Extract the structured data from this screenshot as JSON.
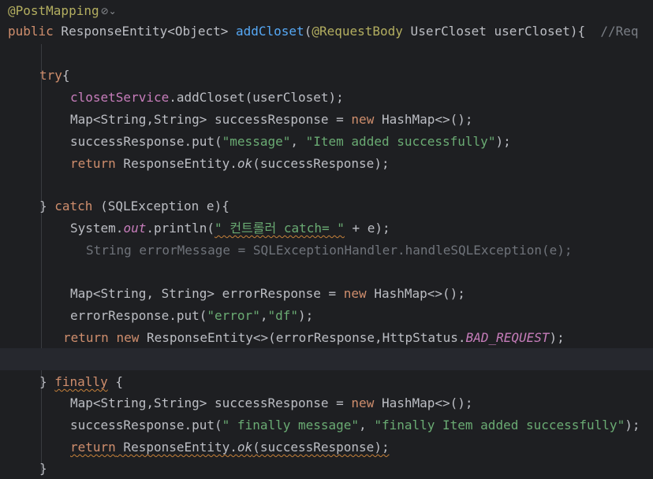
{
  "code": {
    "l1": {
      "ann": "@PostMapping",
      "inlay": "⊘⌄"
    },
    "l2": {
      "kw_public": "public",
      "type": " ResponseEntity<Object> ",
      "method": "addCloset",
      "paren_open": "(",
      "ann": "@RequestBody",
      "param": " UserCloset userCloset){  ",
      "comment": "//Req"
    },
    "l4": {
      "kw": "try",
      "rest": "{"
    },
    "l5": {
      "field": "closetService",
      "rest": ".addCloset(userCloset);"
    },
    "l6": {
      "pre": "Map<String,String> successResponse = ",
      "kw": "new",
      "post": " HashMap<>();"
    },
    "l7": {
      "pre": "successResponse.put(",
      "s1": "\"message\"",
      "mid": ", ",
      "s2": "\"Item added successfully\"",
      "post": ");"
    },
    "l8": {
      "kw": "return",
      "pre": " ResponseEntity.",
      "it": "ok",
      "post": "(successResponse);"
    },
    "l10": {
      "brace": "} ",
      "kw": "catch",
      "rest": " (SQLException e){"
    },
    "l11": {
      "pre": "System.",
      "field": "out",
      "mid": ".println(",
      "str": "\" 컨트롤러 catch= \"",
      "post": " + e);"
    },
    "l12": {
      "text": "String errorMessage = SQLExceptionHandler.handleSQLException(e);"
    },
    "l14": {
      "pre": "Map<String, String> errorResponse = ",
      "kw": "new",
      "post": " HashMap<>();"
    },
    "l15": {
      "pre": "errorResponse.put(",
      "s1": "\"error\"",
      "mid": ",",
      "s2": "\"df\"",
      "post": ");"
    },
    "l16": {
      "kw1": "return",
      "sp": " ",
      "kw2": "new",
      "pre": " ResponseEntity<>(errorResponse,HttpStatus.",
      "field": "BAD_REQUEST",
      "post": ");"
    },
    "l18": {
      "brace": "} ",
      "kw": "finally",
      "rest": " {"
    },
    "l19": {
      "pre": "Map<String,String> successResponse = ",
      "kw": "new",
      "post": " HashMap<>();"
    },
    "l20": {
      "pre": "successResponse.put(",
      "s1": "\" finally message\"",
      "mid": ", ",
      "s2": "\"finally Item added successfully\"",
      "post": ");"
    },
    "l21": {
      "kw": "return",
      "pre": " ResponseEntity.",
      "it": "ok",
      "post": "(successResponse);"
    },
    "l22": {
      "brace": "}"
    }
  },
  "colors": {
    "background": "#1e1f22",
    "keyword": "#cf8e6d",
    "annotation": "#b3ae60",
    "method": "#56a8f5",
    "string": "#6aab73",
    "field": "#c77dbb",
    "comment": "#7a7e85"
  }
}
